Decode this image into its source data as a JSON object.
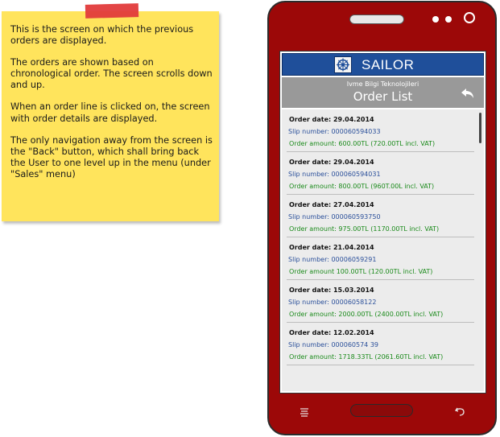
{
  "note": {
    "paragraphs": [
      "This is the screen on which the previous orders are displayed.",
      "The orders are shown based on chronological order. The screen scrolls down and up.",
      "When an order line is clicked on, the screen with order details are displayed.",
      "The only navigation away from the screen is the \"Back\" button, which shall bring back the User to one level up in the menu (under \"Sales\" menu)"
    ]
  },
  "app": {
    "title": "SAILOR",
    "company": "Ivme Bilgi Teknolojileri",
    "page_title": "Order List"
  },
  "orders": [
    {
      "date": "Order date: 29.04.2014",
      "slip": "Slip number: 000060594033",
      "amount": "Order amount: 600.00TL (720.00TL incl. VAT)"
    },
    {
      "date": "Order date: 29.04.2014",
      "slip": "Slip number: 000060594031",
      "amount": "Order amount: 800.00TL (960T.00L incl. VAT)"
    },
    {
      "date": "Order date: 27.04.2014",
      "slip": "Slip number: 000060593750",
      "amount": "Order amount: 975.00TL (1170.00TL incl. VAT)"
    },
    {
      "date": "Order date: 21.04.2014",
      "slip": "Slip number: 00006059291",
      "amount": "Order amount 100.00TL (120.00TL incl. VAT)"
    },
    {
      "date": "Order date: 15.03.2014",
      "slip": "Slip number: 00006058122",
      "amount": "Order amount: 2000.00TL (2400.00TL incl. VAT)"
    },
    {
      "date": "Order date: 12.02.2014",
      "slip": "Slip number: 000060574 39",
      "amount": "Order amount: 1718.33TL (2061.60TL incl. VAT)"
    }
  ],
  "icons": {
    "logo": "ship-wheel-icon",
    "back": "back-arrow-icon",
    "menu": "menu-icon",
    "phone_back": "phone-back-icon"
  },
  "colors": {
    "phone_body": "#9c0808",
    "app_header": "#1f4f9a",
    "subheader": "#999999",
    "note": "#ffe45c",
    "tape": "#e23b3b",
    "slip_text": "#2a4f9a",
    "amount_text": "#1a8a1a"
  }
}
